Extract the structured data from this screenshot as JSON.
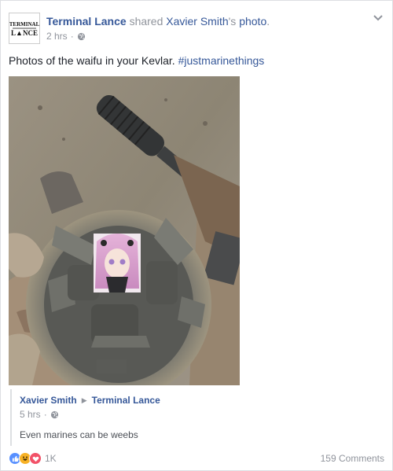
{
  "post": {
    "page_name": "Terminal Lance",
    "shared_word": "shared",
    "source_user": "Xavier Smith",
    "source_suffix": "'s",
    "source_object": "photo",
    "source_end": ".",
    "timestamp": "2 hrs",
    "separator": "·",
    "text_before_hashtag": "Photos of the waifu in your Kevlar. ",
    "hashtag": "#justmarinethings",
    "avatar_line1": "TERMINAL",
    "avatar_line2": "L▲NCE"
  },
  "quoted": {
    "author": "Xavier Smith",
    "target": "Terminal Lance",
    "timestamp": "5 hrs",
    "separator": "·",
    "text": "Even marines can be weebs"
  },
  "footer": {
    "reaction_count": "1K",
    "comments": "159 Comments"
  },
  "colors": {
    "link": "#365899",
    "secondary_text": "#90949c",
    "like": "#5890ff",
    "haha": "#f7b125",
    "love": "#f25268"
  },
  "icons": {
    "privacy": "globe-icon",
    "options": "chevron-down-icon",
    "reactions": [
      "like-icon",
      "haha-icon",
      "love-icon"
    ],
    "quote_arrow": "triangle-right-icon"
  }
}
